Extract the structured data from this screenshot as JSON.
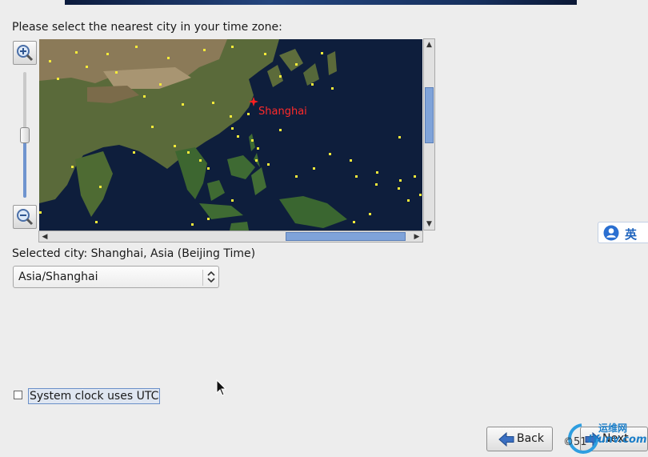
{
  "prompt": "Please select the nearest city in your time zone:",
  "map": {
    "highlighted_city": "Shanghai",
    "marker_color": "#ff2020",
    "city_dot_color": "#f4ea3a",
    "zoom_level": 0.46
  },
  "zoom": {
    "in_icon": "zoom-in-icon",
    "out_icon": "zoom-out-icon"
  },
  "selected_city": "Selected city: Shanghai, Asia (Beijing Time)",
  "timezone_select": {
    "value": "Asia/Shanghai"
  },
  "utc_checkbox": {
    "label": "System clock uses UTC",
    "checked": false
  },
  "ime": {
    "label": "英",
    "icon": "user-icon"
  },
  "buttons": {
    "back": "Back",
    "next": "Next"
  },
  "watermark": {
    "site": "运维网",
    "domain": "iYunv.com",
    "prefix": "©51"
  },
  "colors": {
    "accent": "#7fa3d9",
    "background": "#ededed"
  }
}
